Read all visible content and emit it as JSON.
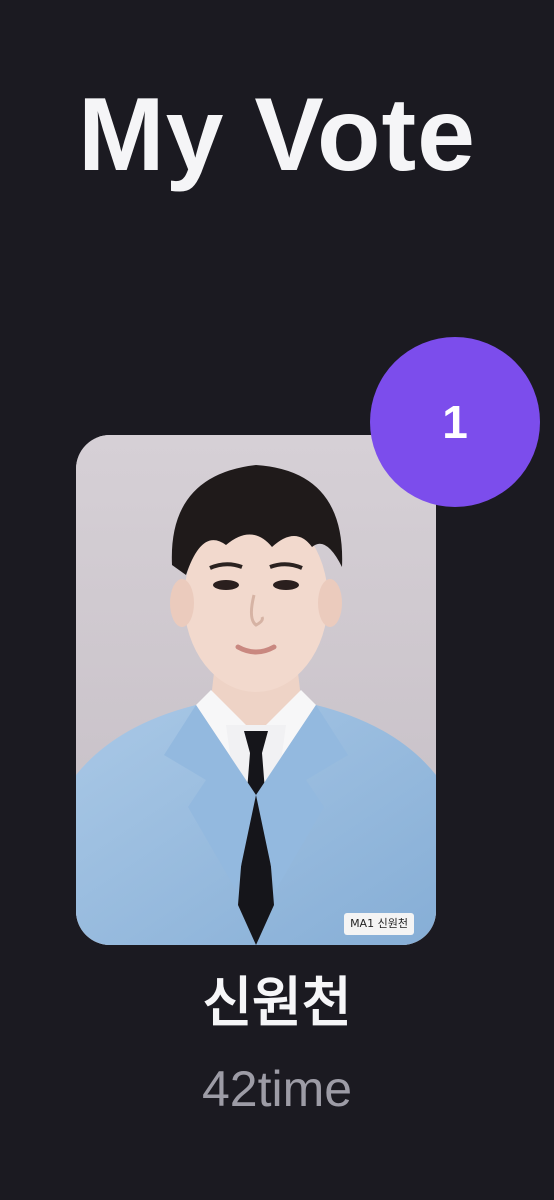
{
  "header": {
    "title": "My Vote"
  },
  "vote_card": {
    "rank": "1",
    "name": "신원천",
    "count": "42time",
    "photo": "candidate-portrait",
    "name_tag": "MA1 신원천"
  },
  "colors": {
    "background": "#1b1a21",
    "badge": "#7c4dec",
    "title": "#f5f5f7",
    "count": "#9d9ca6"
  }
}
